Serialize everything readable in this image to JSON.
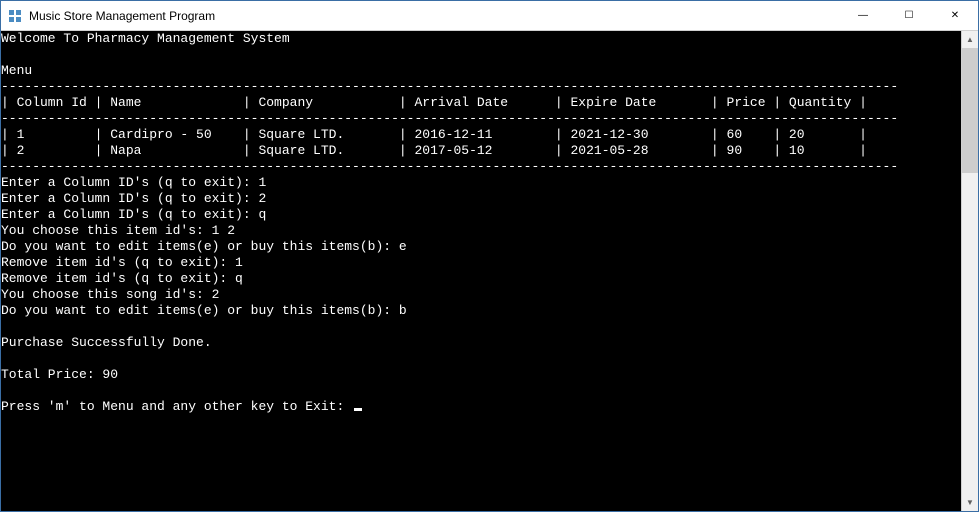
{
  "window": {
    "title": "Music Store Management Program",
    "controls": {
      "minimize": "—",
      "maximize": "☐",
      "close": "✕"
    }
  },
  "console": {
    "welcome": "Welcome To Pharmacy Management System",
    "menu_label": "Menu",
    "table": {
      "headers": [
        "Column Id",
        "Name",
        "Company",
        "Arrival Date",
        "Expire Date",
        "Price",
        "Quantity"
      ],
      "rows": [
        {
          "id": "1",
          "name": "Cardipro - 50",
          "company": "Square LTD.",
          "arrival": "2016-12-11",
          "expire": "2021-12-30",
          "price": "60",
          "quantity": "20"
        },
        {
          "id": "2",
          "name": "Napa",
          "company": "Square LTD.",
          "arrival": "2017-05-12",
          "expire": "2021-05-28",
          "price": "90",
          "quantity": "10"
        }
      ]
    },
    "prompts": [
      {
        "label": "Enter a Column ID's (q to exit): ",
        "input": "1"
      },
      {
        "label": "Enter a Column ID's (q to exit): ",
        "input": "2"
      },
      {
        "label": "Enter a Column ID's (q to exit): ",
        "input": "q"
      },
      {
        "label": "You choose this item id's: ",
        "input": "1 2"
      },
      {
        "label": "Do you want to edit items(e) or buy this items(b): ",
        "input": "e"
      },
      {
        "label": "Remove item id's (q to exit): ",
        "input": "1"
      },
      {
        "label": "Remove item id's (q to exit): ",
        "input": "q"
      },
      {
        "label": "You choose this song id's: ",
        "input": "2"
      },
      {
        "label": "Do you want to edit items(e) or buy this items(b): ",
        "input": "b"
      }
    ],
    "purchase_done": "Purchase Successfully Done.",
    "total_prefix": "Total Price: ",
    "total_value": "90",
    "exit_prompt": "Press 'm' to Menu and any other key to Exit: "
  }
}
